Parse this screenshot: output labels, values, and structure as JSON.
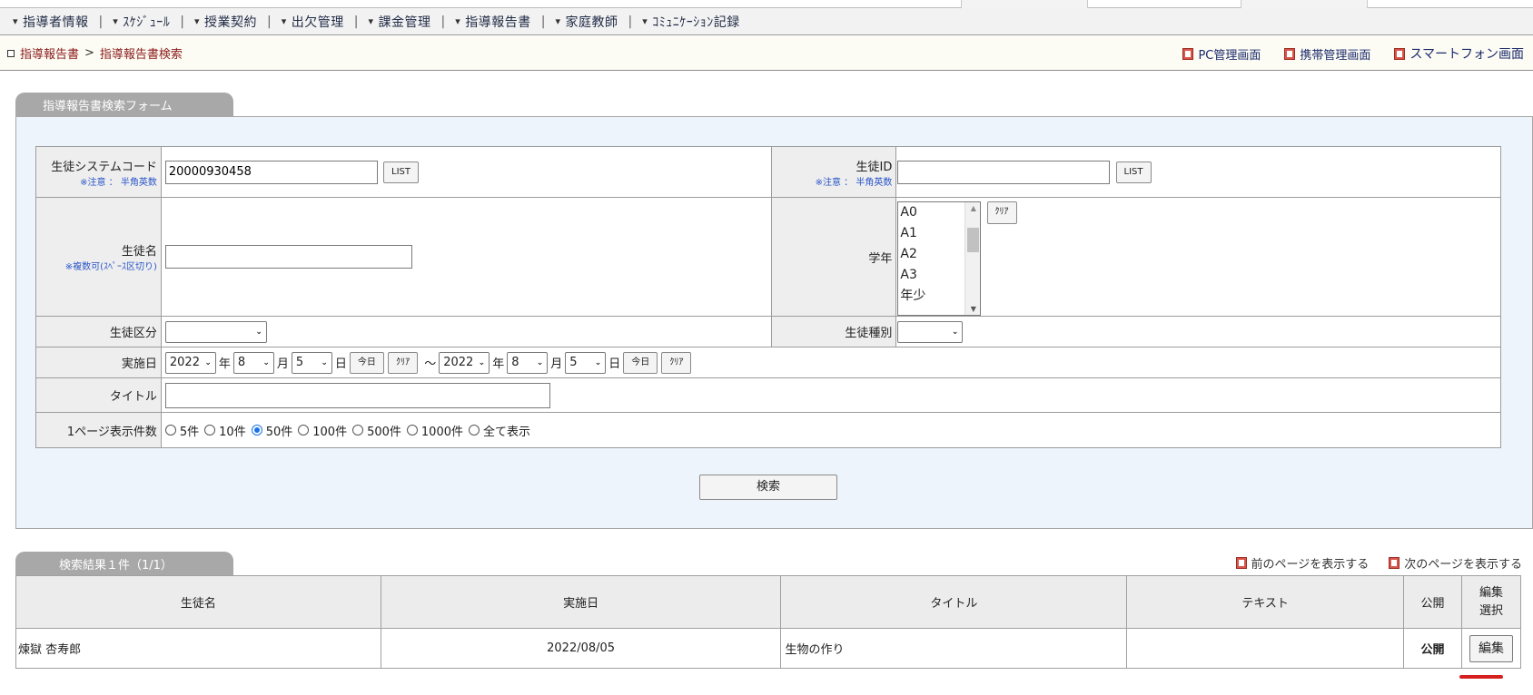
{
  "menu": {
    "items": [
      "指導者情報",
      "ｽｹｼﾞｭｰﾙ",
      "授業契約",
      "出欠管理",
      "課金管理",
      "指導報告書",
      "家庭教師",
      "ｺﾐｭﾆｹｰｼｮﾝ記録"
    ],
    "separator": "|",
    "item_icon": "triangle-down-icon"
  },
  "breadcrumb": {
    "parent": "指導報告書",
    "separator": ">",
    "current": "指導報告書検索"
  },
  "header_links": [
    "PC管理画面",
    "携帯管理画面",
    "スマートフォン画面"
  ],
  "search_form": {
    "tab_title": "指導報告書検索フォーム",
    "student_system_code": {
      "label": "生徒システムコード",
      "note": "※注意 ： 半角英数",
      "value": "20000930458",
      "list_button": "LIST"
    },
    "student_id": {
      "label": "生徒ID",
      "note": "※注意 ： 半角英数",
      "value": "",
      "list_button": "LIST"
    },
    "student_name": {
      "label": "生徒名",
      "note": "※複数可(ｽﾍﾟｰｽ区切り)",
      "value": ""
    },
    "grade": {
      "label": "学年",
      "options": [
        "A0",
        "A1",
        "A2",
        "A3",
        "年少"
      ],
      "clear_button": "ｸﾘｱ"
    },
    "student_category": {
      "label": "生徒区分",
      "value": ""
    },
    "student_type": {
      "label": "生徒種別",
      "value": ""
    },
    "date": {
      "label": "実施日",
      "from": {
        "year": "2022",
        "month": "8",
        "day": "5"
      },
      "to": {
        "year": "2022",
        "month": "8",
        "day": "5"
      },
      "year_unit": "年",
      "month_unit": "月",
      "day_unit": "日",
      "today_button": "今日",
      "clear_button": "ｸﾘｱ",
      "range_separator": "～"
    },
    "title_field": {
      "label": "タイトル",
      "value": ""
    },
    "per_page": {
      "label": "1ページ表示件数",
      "options": [
        "5件",
        "10件",
        "50件",
        "100件",
        "500件",
        "1000件",
        "全て表示"
      ],
      "selected": "50件"
    },
    "search_button": "検索"
  },
  "results": {
    "tab_title": "検索結果１件（1/1）",
    "prev_page": "前のページを表示する",
    "next_page": "次のページを表示する",
    "columns": [
      "生徒名",
      "実施日",
      "タイトル",
      "テキスト",
      "公開",
      "編集選択"
    ],
    "rows": [
      {
        "student_name": "煉獄 杏寿郎",
        "date": "2022/08/05",
        "title": "生物の作り",
        "text": "",
        "published": "公開",
        "edit_button": "編集"
      }
    ]
  },
  "colors": {
    "breadcrumb_link": "#8b1a1a",
    "note_text": "#2b56c8",
    "panel_background": "#eef4fb",
    "tab_header": "#a8a8a8",
    "highlight_mark": "#d62020"
  }
}
